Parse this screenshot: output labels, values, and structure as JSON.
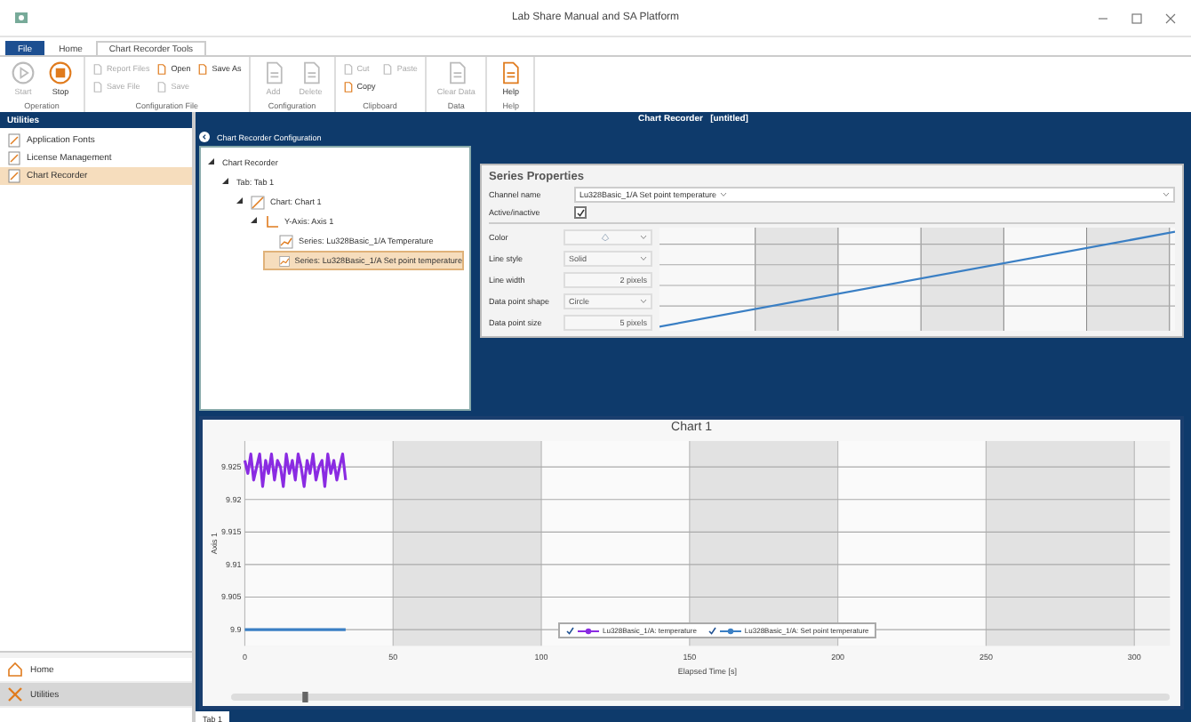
{
  "window": {
    "title": "Lab Share Manual and SA Platform"
  },
  "ribbon": {
    "tabs": [
      {
        "label": "File",
        "selected": false,
        "kind": "file"
      },
      {
        "label": "Home",
        "selected": false,
        "kind": "plain"
      },
      {
        "label": "Chart Recorder Tools",
        "selected": true,
        "kind": "plain"
      }
    ],
    "groups": [
      {
        "label": "Operation",
        "buttons": [
          {
            "label": "Start",
            "kind": "large",
            "disabled": true
          },
          {
            "label": "Stop",
            "kind": "large",
            "disabled": false
          }
        ]
      },
      {
        "label": "Configuration File",
        "buttons": [
          {
            "label": "Report Files",
            "kind": "small",
            "disabled": true
          },
          {
            "label": "Save File",
            "kind": "small",
            "disabled": true
          },
          {
            "label": "Open",
            "kind": "small",
            "disabled": false
          },
          {
            "label": "Save",
            "kind": "small",
            "disabled": true
          },
          {
            "label": "Save As",
            "kind": "small",
            "disabled": false
          }
        ]
      },
      {
        "label": "Configuration",
        "buttons": [
          {
            "label": "Add",
            "kind": "large",
            "disabled": true
          },
          {
            "label": "Delete",
            "kind": "large",
            "disabled": true
          }
        ]
      },
      {
        "label": "Clipboard",
        "buttons": [
          {
            "label": "Cut",
            "kind": "small",
            "disabled": true
          },
          {
            "label": "Copy",
            "kind": "small",
            "disabled": false
          },
          {
            "label": "Paste",
            "kind": "small",
            "disabled": true
          }
        ]
      },
      {
        "label": "Data",
        "buttons": [
          {
            "label": "Clear Data",
            "kind": "large",
            "disabled": true
          }
        ]
      },
      {
        "label": "Help",
        "buttons": [
          {
            "label": "Help",
            "kind": "large",
            "disabled": false
          }
        ]
      }
    ]
  },
  "sidebar": {
    "title": "Utilities",
    "items": [
      {
        "label": "Application Fonts",
        "selected": false
      },
      {
        "label": "License Management",
        "selected": false
      },
      {
        "label": "Chart Recorder",
        "selected": true
      }
    ],
    "nav": [
      {
        "label": "Home",
        "selected": false
      },
      {
        "label": "Utilities",
        "selected": true
      }
    ]
  },
  "header": {
    "title": "Chart Recorder   [untitled]"
  },
  "configuration": {
    "title": "Chart Recorder Configuration",
    "tree": [
      {
        "label": "Chart Recorder",
        "expanded": true,
        "selected": false,
        "children": [
          {
            "label": "Tab: Tab 1",
            "expanded": true,
            "selected": false,
            "children": [
              {
                "label": "Chart: Chart 1",
                "kind": "chart",
                "expanded": true,
                "selected": false,
                "children": [
                  {
                    "label": "Y-Axis: Axis 1",
                    "kind": "axis",
                    "expanded": true,
                    "selected": false,
                    "children": [
                      {
                        "label": "Series: Lu328Basic_1/A Temperature",
                        "kind": "series",
                        "selected": false
                      },
                      {
                        "label": "Series: Lu328Basic_1/A Set point temperature",
                        "kind": "series",
                        "selected": true
                      }
                    ]
                  }
                ]
              }
            ]
          }
        ]
      }
    ]
  },
  "properties": {
    "title": "Series Properties",
    "channel": {
      "label": "Channel name",
      "value": "Lu328Basic_1/A Set point temperature"
    },
    "active": {
      "label": "Active/inactive",
      "checked": true
    },
    "fields": [
      {
        "label": "Color",
        "kind": "color"
      },
      {
        "label": "Line style",
        "kind": "dropdown",
        "value": "Solid"
      },
      {
        "label": "Line width",
        "kind": "text",
        "value": "2 pixels"
      },
      {
        "label": "Data point shape",
        "kind": "dropdown",
        "value": "Circle"
      },
      {
        "label": "Data point size",
        "kind": "text",
        "value": "5 pixels"
      }
    ]
  },
  "chart_panel": {
    "legend": [
      {
        "checked": true
      },
      {
        "checked": true
      }
    ],
    "chart_data": {
      "type": "line",
      "grid": true,
      "title": "Chart 1",
      "xlabel": "Elapsed Time [s]",
      "ylabel": "Axis 1",
      "x": [
        0,
        1,
        2,
        3,
        4,
        5,
        6,
        7,
        8,
        9,
        10,
        11,
        12,
        13,
        14,
        15,
        16,
        17,
        18,
        19,
        20,
        21,
        22,
        23,
        24,
        25,
        26,
        27,
        28,
        29,
        30,
        31,
        32,
        33,
        34
      ],
      "series": [
        {
          "name": "Lu328Basic_1/A: temperature",
          "color": "#8a2be2",
          "values": [
            9.926,
            9.924,
            9.927,
            9.923,
            9.925,
            9.927,
            9.922,
            9.926,
            9.924,
            9.927,
            9.923,
            9.926,
            9.925,
            9.922,
            9.927,
            9.924,
            9.926,
            9.923,
            9.927,
            9.925,
            9.922,
            9.926,
            9.924,
            9.927,
            9.923,
            9.925,
            9.926,
            9.922,
            9.927,
            9.924,
            9.926,
            9.923,
            9.925,
            9.927,
            9.923
          ]
        },
        {
          "name": "Lu328Basic_1/A: Set point temperature",
          "color": "#3a7fc4",
          "values": [
            9.9,
            9.9,
            9.9,
            9.9,
            9.9,
            9.9,
            9.9,
            9.9,
            9.9,
            9.9,
            9.9,
            9.9,
            9.9,
            9.9,
            9.9,
            9.9,
            9.9,
            9.9,
            9.9,
            9.9,
            9.9,
            9.9,
            9.9,
            9.9,
            9.9,
            9.9,
            9.9,
            9.9,
            9.9,
            9.9,
            9.9,
            9.9,
            9.9,
            9.9,
            9.9
          ]
        }
      ],
      "xlim": [
        0,
        312
      ],
      "ylim": [
        9.8975,
        9.929
      ],
      "xticks": [
        0,
        50,
        100,
        150,
        200,
        250,
        300
      ],
      "yticks": [
        {
          "value": 9.9,
          "label": "9.9"
        },
        {
          "value": 9.905,
          "label": "9.905"
        },
        {
          "value": 9.91,
          "label": "9.91"
        },
        {
          "value": 9.915,
          "label": "9.915"
        },
        {
          "value": 9.92,
          "label": "9.92"
        },
        {
          "value": 9.925,
          "label": "9.925"
        }
      ]
    }
  },
  "bottom_tabs": [
    {
      "label": "Tab 1",
      "selected": true
    }
  ]
}
